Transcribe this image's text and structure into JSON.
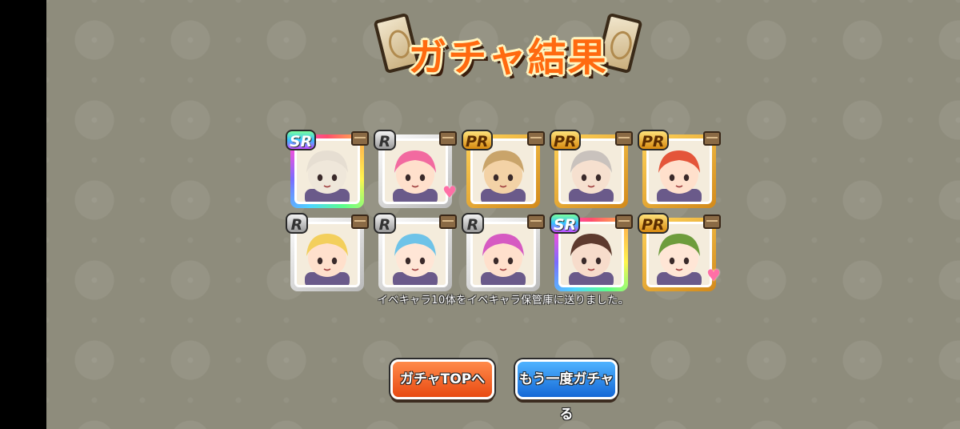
{
  "title": "ガチャ結果",
  "results": [
    {
      "rarity": "SR",
      "skin": "#efe7da",
      "hair": "#e6ded2"
    },
    {
      "rarity": "R",
      "skin": "#ffe0cc",
      "hair": "#f26aa0"
    },
    {
      "rarity": "PR",
      "skin": "#f3d2a6",
      "hair": "#c9a46a"
    },
    {
      "rarity": "PR",
      "skin": "#f6e0cf",
      "hair": "#c9c2bd"
    },
    {
      "rarity": "PR",
      "skin": "#ffe0cc",
      "hair": "#e4553a"
    },
    {
      "rarity": "R",
      "skin": "#ffe0cc",
      "hair": "#f3cf5c"
    },
    {
      "rarity": "R",
      "skin": "#ffe6d6",
      "hair": "#6ec3e8"
    },
    {
      "rarity": "R",
      "skin": "#ffe0cc",
      "hair": "#d65ac2"
    },
    {
      "rarity": "SR",
      "skin": "#f7dccb",
      "hair": "#5e3a2e"
    },
    {
      "rarity": "PR",
      "skin": "#ffe6d6",
      "hair": "#6e9c3c"
    }
  ],
  "message": "イベキャラ10体をイベキャラ保管庫に送りました。",
  "buttons": {
    "gacha_top": "ガチャTOPへ",
    "again": "もう一度ガチャる"
  },
  "colors": {
    "background": "#8e8c7c",
    "title": "#ff6a10",
    "button_orange": "#e84a12",
    "button_blue": "#1568d6"
  }
}
